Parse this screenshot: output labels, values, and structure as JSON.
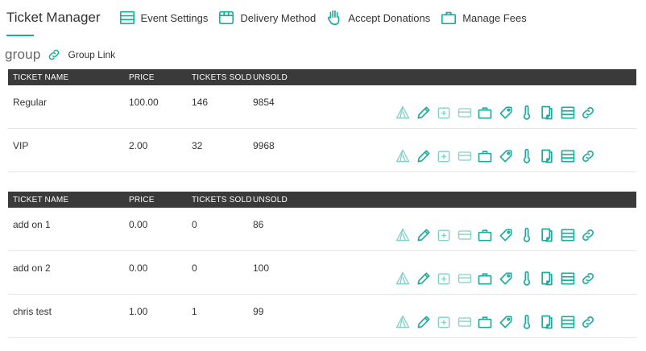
{
  "header": {
    "title": "Ticket Manager",
    "nav": [
      {
        "label": "Event Settings",
        "icon": "list-icon"
      },
      {
        "label": "Delivery Method",
        "icon": "box-icon"
      },
      {
        "label": "Accept Donations",
        "icon": "hand-icon"
      },
      {
        "label": "Manage Fees",
        "icon": "briefcase-icon"
      }
    ]
  },
  "group": {
    "label": "group",
    "link_label": "Group Link"
  },
  "columns": {
    "name": "TICKET NAME",
    "price": "PRICE",
    "sold": "TICKETS SOLD",
    "unsold": "UNSOLD"
  },
  "tickets": [
    {
      "name": "Regular",
      "price": "100.00",
      "sold": "146",
      "unsold": "9854"
    },
    {
      "name": "VIP",
      "price": "2.00",
      "sold": "32",
      "unsold": "9968"
    }
  ],
  "addons": [
    {
      "name": "add on 1",
      "price": "0.00",
      "sold": "0",
      "unsold": "86"
    },
    {
      "name": "add on 2",
      "price": "0.00",
      "sold": "0",
      "unsold": "100"
    },
    {
      "name": "chris test",
      "price": "1.00",
      "sold": "1",
      "unsold": "99"
    }
  ],
  "row_actions": [
    "tent-icon",
    "pencil-icon",
    "medical-kit-icon",
    "card-icon",
    "briefcase-icon",
    "tag-icon",
    "thermometer-icon",
    "copy-icon",
    "list-icon",
    "link-icon"
  ],
  "colors": {
    "accent": "#1aab9b",
    "header_bg": "#3a3a3a"
  }
}
